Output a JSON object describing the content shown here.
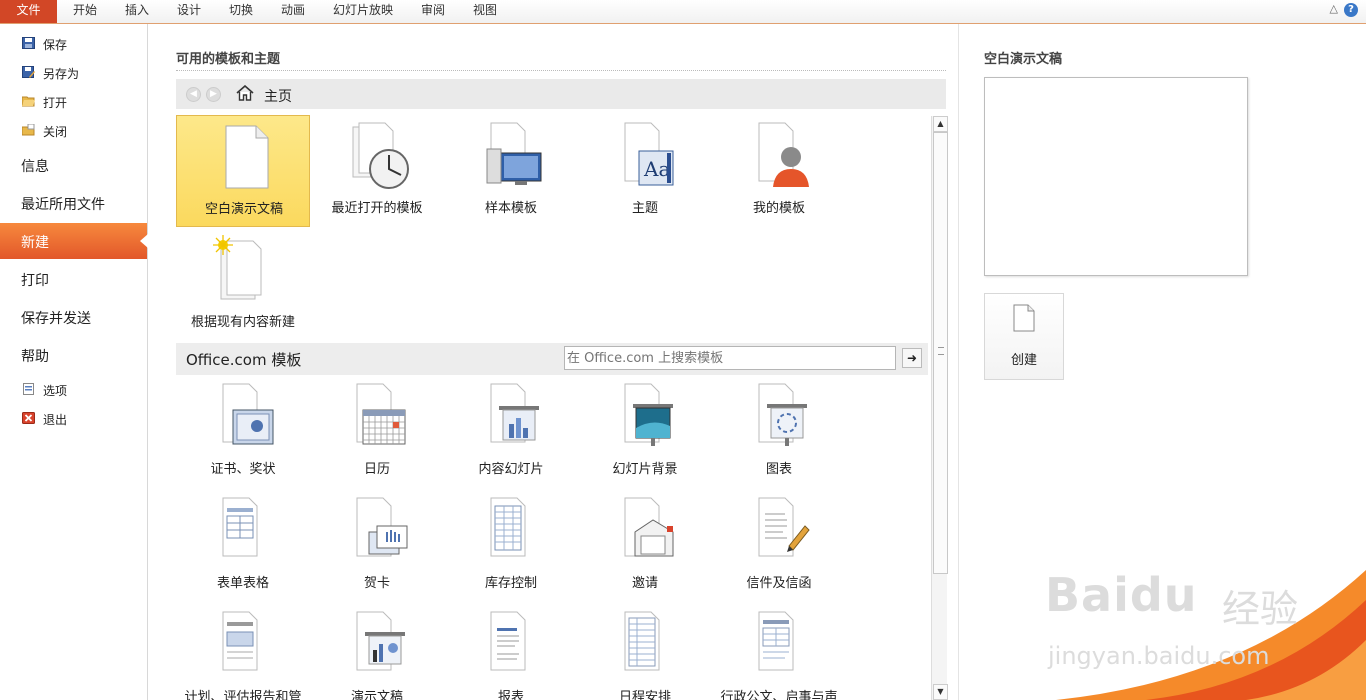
{
  "ribbon": {
    "file_tab": "文件",
    "tabs": [
      "开始",
      "插入",
      "设计",
      "切换",
      "动画",
      "幻灯片放映",
      "审阅",
      "视图"
    ],
    "help": "?"
  },
  "leftnav": {
    "items": [
      {
        "label": "保存",
        "icon": "save-icon"
      },
      {
        "label": "另存为",
        "icon": "save-as-icon"
      },
      {
        "label": "打开",
        "icon": "open-folder-icon"
      },
      {
        "label": "关闭",
        "icon": "close-folder-icon"
      }
    ],
    "sections": [
      "信息",
      "最近所用文件",
      "新建",
      "打印",
      "保存并发送",
      "帮助"
    ],
    "active_section": "新建",
    "bottom_items": [
      {
        "label": "选项",
        "icon": "options-icon"
      },
      {
        "label": "退出",
        "icon": "exit-icon"
      }
    ]
  },
  "center": {
    "section_title": "可用的模板和主题",
    "home_label": "主页",
    "home_templates": [
      {
        "label": "空白演示文稿",
        "icon": "blank-presentation-icon",
        "selected": true
      },
      {
        "label": "最近打开的模板",
        "icon": "recent-templates-icon"
      },
      {
        "label": "样本模板",
        "icon": "sample-templates-icon"
      },
      {
        "label": "主题",
        "icon": "themes-icon"
      },
      {
        "label": "我的模板",
        "icon": "my-templates-icon"
      },
      {
        "label": "根据现有内容新建",
        "icon": "new-from-existing-icon"
      }
    ],
    "office_title": "Office.com 模板",
    "office_search_placeholder": "在 Office.com 上搜索模板",
    "office_templates": [
      {
        "label": "证书、奖状",
        "icon": "certificate-icon"
      },
      {
        "label": "日历",
        "icon": "calendar-icon"
      },
      {
        "label": "内容幻灯片",
        "icon": "content-slides-icon"
      },
      {
        "label": "幻灯片背景",
        "icon": "slide-background-icon"
      },
      {
        "label": "图表",
        "icon": "diagram-icon"
      },
      {
        "label": "表单表格",
        "icon": "forms-icon"
      },
      {
        "label": "贺卡",
        "icon": "greeting-card-icon"
      },
      {
        "label": "库存控制",
        "icon": "inventory-icon"
      },
      {
        "label": "邀请",
        "icon": "invitation-icon"
      },
      {
        "label": "信件及信函",
        "icon": "letters-icon"
      },
      {
        "label": "计划、评估报告和管",
        "icon": "plans-icon"
      },
      {
        "label": "演示文稿",
        "icon": "presentations-icon"
      },
      {
        "label": "报表",
        "icon": "reports-icon"
      },
      {
        "label": "日程安排",
        "icon": "schedules-icon"
      },
      {
        "label": "行政公文、启事与声",
        "icon": "notices-icon"
      }
    ]
  },
  "right": {
    "preview_title": "空白演示文稿",
    "create_label": "创建"
  },
  "watermark": {
    "logo_text": "Baidu",
    "logo_cn": "经验",
    "url": "jingyan.baidu.com"
  },
  "colors": {
    "accent": "#d24726",
    "active_nav": "#e9652f",
    "selected_tile": "#fbd95e"
  }
}
